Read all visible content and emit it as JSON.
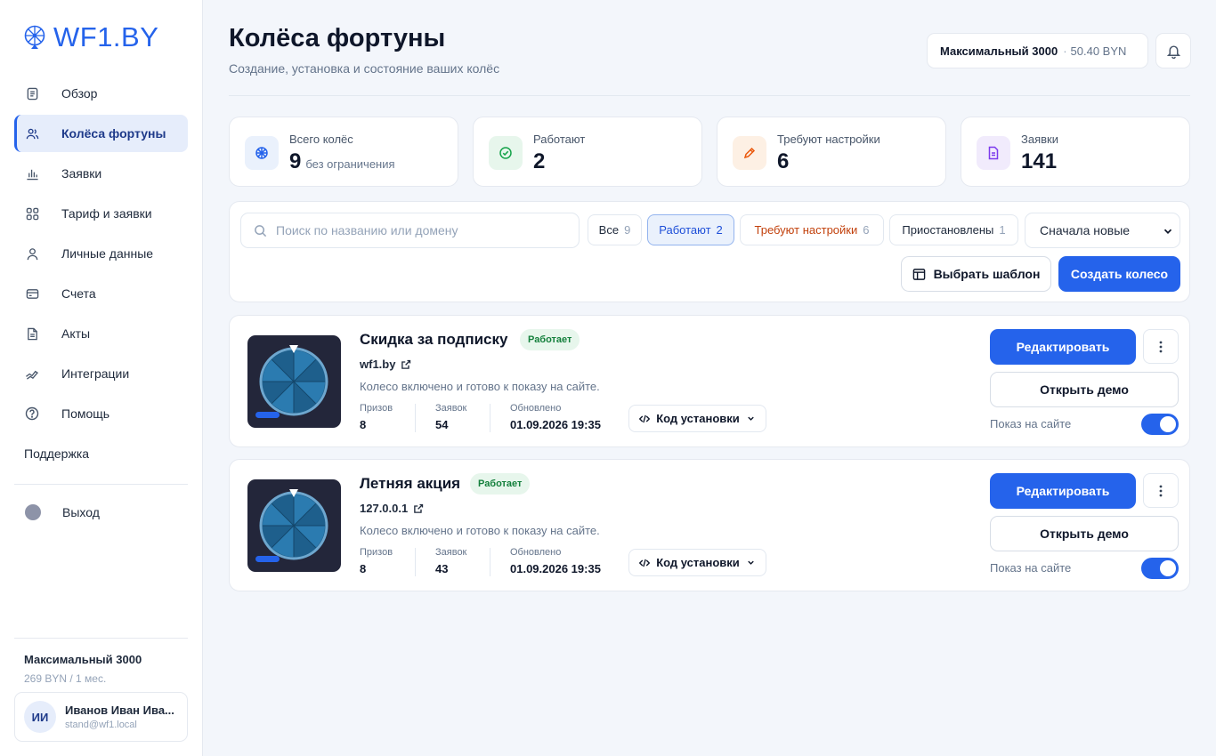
{
  "brand": {
    "name": "WF1.BY"
  },
  "sidebar": {
    "items": [
      {
        "label": "Обзор",
        "icon": "document-icon"
      },
      {
        "label": "Колёса фортуны",
        "icon": "users-icon",
        "active": true
      },
      {
        "label": "Заявки",
        "icon": "bar-chart-icon"
      },
      {
        "label": "Тариф и заявки",
        "icon": "grid-icon"
      },
      {
        "label": "Личные данные",
        "icon": "user-icon"
      },
      {
        "label": "Счета",
        "icon": "credit-card-icon"
      },
      {
        "label": "Акты",
        "icon": "file-icon"
      },
      {
        "label": "Интеграции",
        "icon": "link-icon"
      },
      {
        "label": "Помощь",
        "icon": "help-circle-icon"
      }
    ],
    "support": "Поддержка",
    "logout": "Выход",
    "plan": {
      "name": "Максимальный 3000",
      "price": "269 BYN / 1 мес."
    },
    "user": {
      "initials": "ИИ",
      "name": "Иванов Иван Ива...",
      "email": "stand@wf1.local"
    }
  },
  "header": {
    "title": "Колёса фортуны",
    "subtitle": "Создание, установка и состояние ваших колёс",
    "plan_name": "Максимальный 3000",
    "separator": "·",
    "balance": "50.40 BYN"
  },
  "stats": [
    {
      "label": "Всего колёс",
      "value": "9",
      "note": "без ограничения",
      "icon": "wheel-icon",
      "color": "#2563eb",
      "bg": "#eaf1fc"
    },
    {
      "label": "Работают",
      "value": "2",
      "note": "",
      "icon": "check-circle-icon",
      "color": "#16a34a",
      "bg": "#e7f6ec"
    },
    {
      "label": "Требуют настройки",
      "value": "6",
      "note": "",
      "icon": "pencil-icon",
      "color": "#ea580c",
      "bg": "#fdf0e4"
    },
    {
      "label": "Заявки",
      "value": "141",
      "note": "",
      "icon": "file-text-icon",
      "color": "#7c3aed",
      "bg": "#f1ebfc"
    }
  ],
  "filters": {
    "search_placeholder": "Поиск по названию или домену",
    "chips": [
      {
        "label": "Все",
        "count": "9"
      },
      {
        "label": "Работают",
        "count": "2",
        "active": true
      },
      {
        "label": "Требуют настройки",
        "count": "6",
        "warn": true
      },
      {
        "label": "Приостановлены",
        "count": "1"
      }
    ],
    "sort_selected": "Сначала новые",
    "template_button": "Выбрать шаблон",
    "create_button": "Создать колесо"
  },
  "wheels": [
    {
      "title": "Скидка за подписку",
      "status": "Работает",
      "domain": "wf1.by",
      "description": "Колесо включено и готово к показу на сайте.",
      "prizes_label": "Призов",
      "prizes": "8",
      "leads_label": "Заявок",
      "leads": "54",
      "updated_label": "Обновлено",
      "updated": "01.09.2026 19:35",
      "code_button": "Код установки",
      "edit_button": "Редактировать",
      "demo_button": "Открыть демо",
      "show_label": "Показ на сайте",
      "show_enabled": true
    },
    {
      "title": "Летняя акция",
      "status": "Работает",
      "domain": "127.0.0.1",
      "description": "Колесо включено и готово к показу на сайте.",
      "prizes_label": "Призов",
      "prizes": "8",
      "leads_label": "Заявок",
      "leads": "43",
      "updated_label": "Обновлено",
      "updated": "01.09.2026 19:35",
      "code_button": "Код установки",
      "edit_button": "Редактировать",
      "demo_button": "Открыть демо",
      "show_label": "Показ на сайте",
      "show_enabled": true
    }
  ]
}
